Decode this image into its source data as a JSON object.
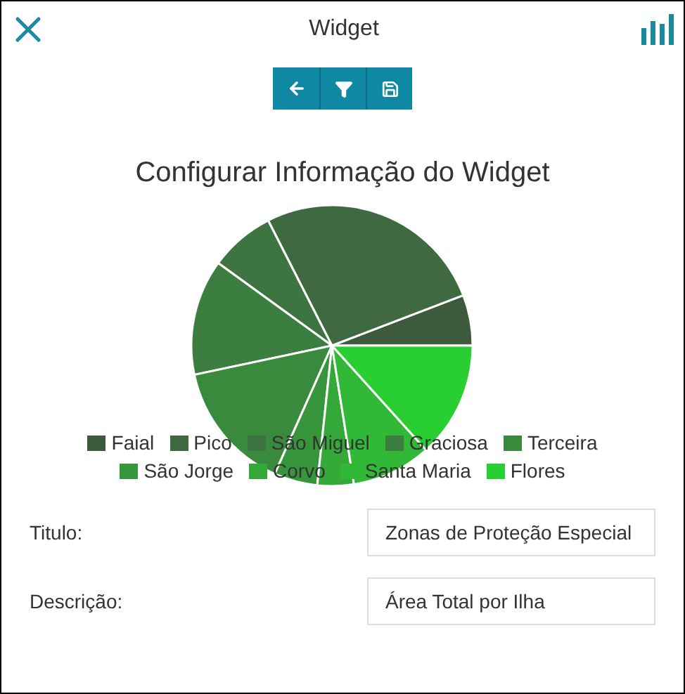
{
  "window": {
    "title": "Widget"
  },
  "toolbar": [
    {
      "kind": "back"
    },
    {
      "kind": "filter"
    },
    {
      "kind": "save"
    }
  ],
  "heading": "Configurar Informação do Widget",
  "legend": [
    {
      "label": "Faial",
      "color": "#3d5a3c"
    },
    {
      "label": "Pico",
      "color": "#3f6a41"
    },
    {
      "label": "São Miguel",
      "color": "#3e7441"
    },
    {
      "label": "Graciosa",
      "color": "#3b7e3f"
    },
    {
      "label": "Terceira",
      "color": "#398a3d"
    },
    {
      "label": "São Jorge",
      "color": "#37963c"
    },
    {
      "label": "Corvo",
      "color": "#34a939"
    },
    {
      "label": "Santa Maria",
      "color": "#30b836"
    },
    {
      "label": "Flores",
      "color": "#29cf31"
    }
  ],
  "fields": [
    {
      "label": "Titulo:",
      "value": "Zonas de Proteção Especial"
    },
    {
      "label": "Descrição:",
      "value": "Área Total por Ilha"
    }
  ]
}
